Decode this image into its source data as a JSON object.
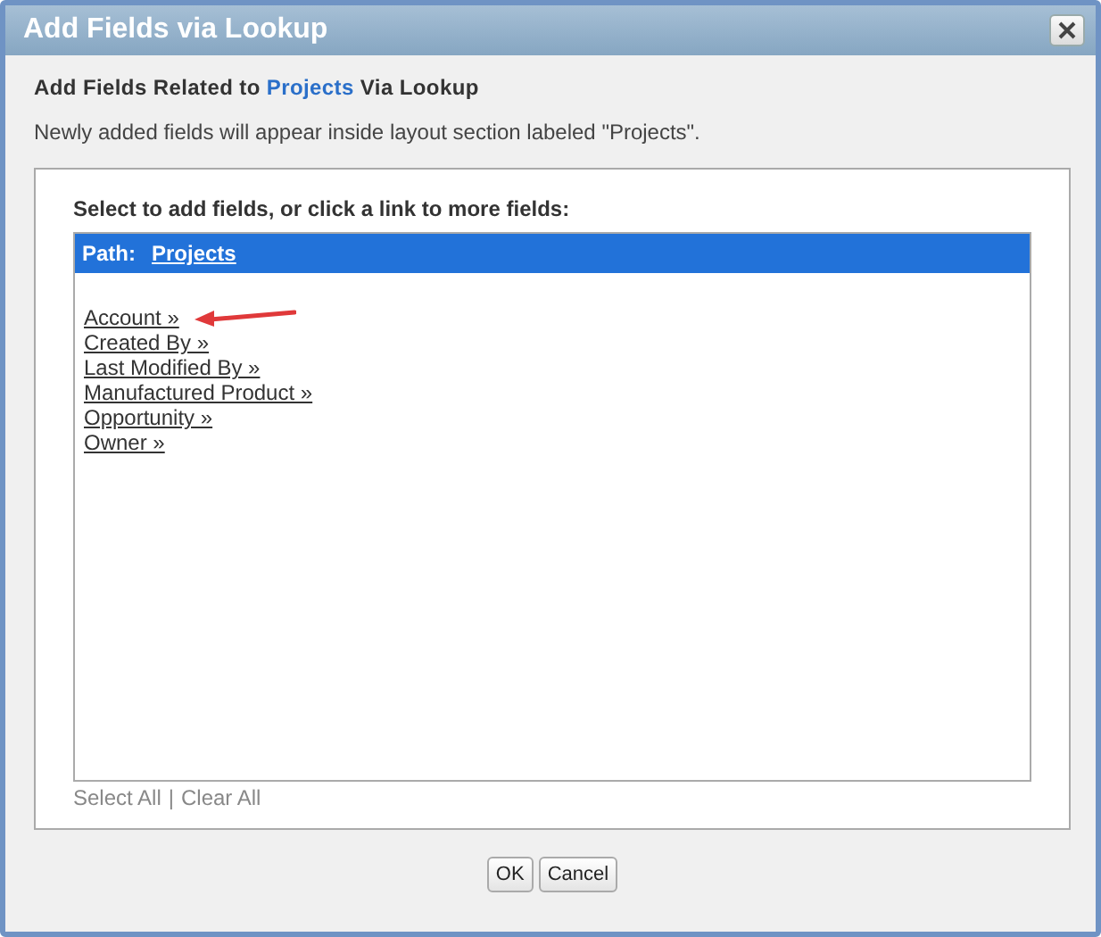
{
  "window": {
    "title": "Add Fields via Lookup"
  },
  "heading": {
    "before": "Add Fields Related to",
    "link": "Projects",
    "after": "Via Lookup"
  },
  "note": "Newly added fields will appear inside layout section labeled \"Projects\".",
  "instruction": "Select to add fields, or click a link to more fields:",
  "path": {
    "label": "Path:",
    "link": "Projects"
  },
  "fields": [
    {
      "label": "Account »",
      "pointed": true
    },
    {
      "label": "Created By »",
      "pointed": false
    },
    {
      "label": "Last Modified By »",
      "pointed": false
    },
    {
      "label": "Manufactured Product »",
      "pointed": false
    },
    {
      "label": "Opportunity »",
      "pointed": false
    },
    {
      "label": "Owner »",
      "pointed": false
    }
  ],
  "selection_links": [
    "Select All",
    "Clear All"
  ],
  "separator": "|",
  "buttons": [
    "OK",
    "Cancel"
  ]
}
